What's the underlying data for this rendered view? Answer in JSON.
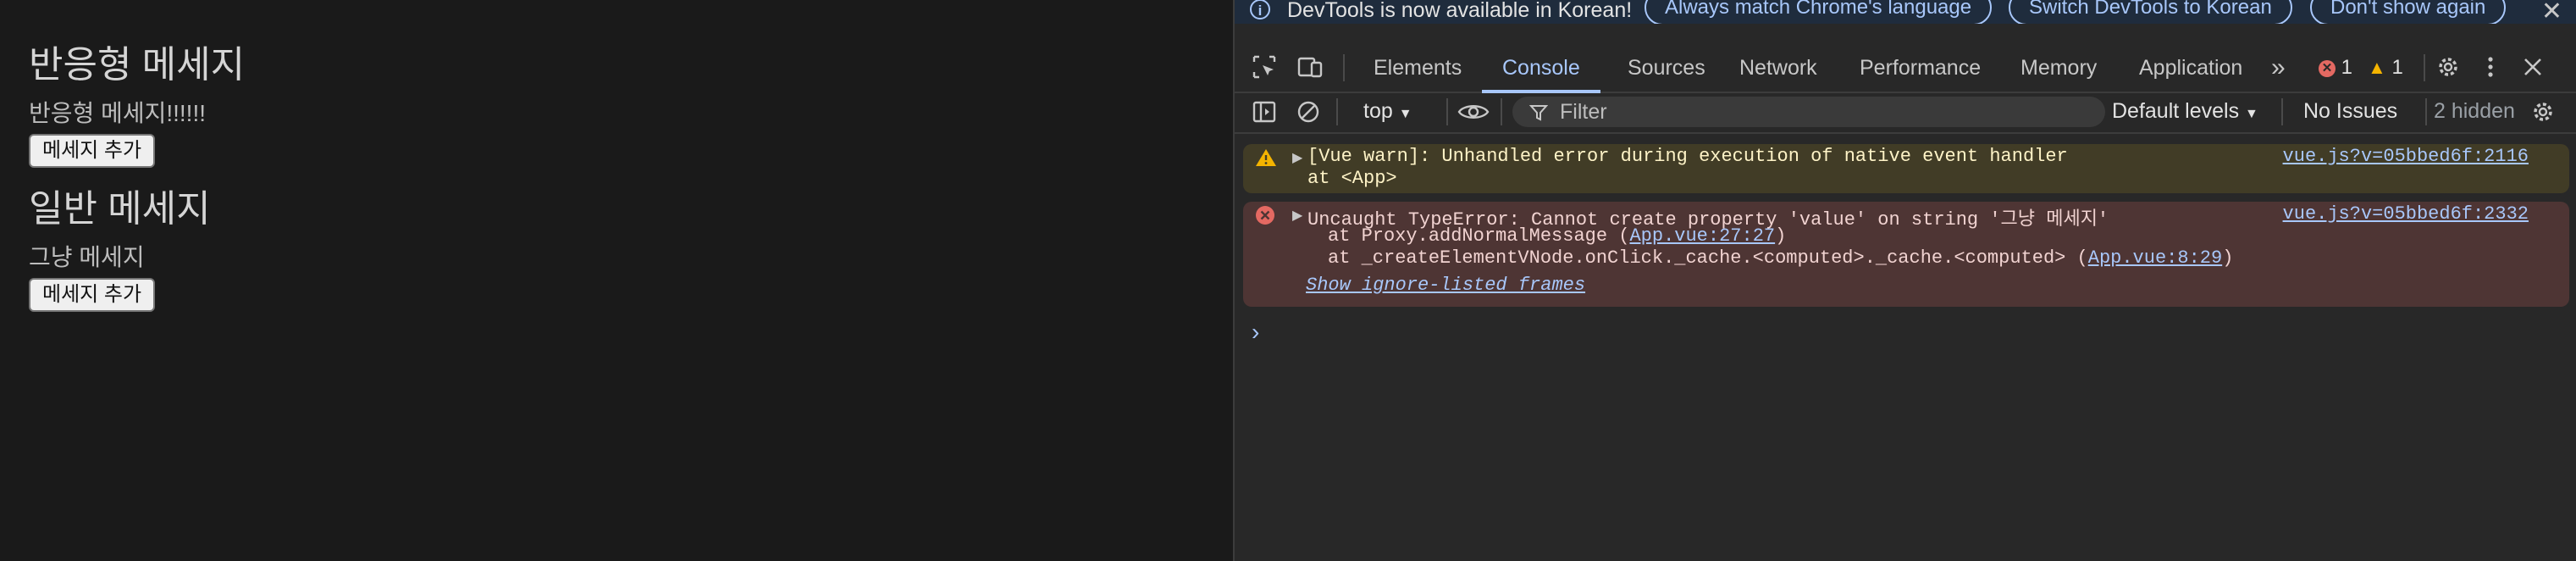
{
  "page": {
    "reactive_title": "반응형 메세지",
    "reactive_text": "반응형 메세지!!!!!!",
    "reactive_button": "메세지 추가",
    "normal_title": "일반 메세지",
    "normal_text": "그냥 메세지",
    "normal_button": "메세지 추가"
  },
  "devtools": {
    "infobar": {
      "message": "DevTools is now available in Korean!",
      "btn_match": "Always match Chrome's language",
      "btn_switch": "Switch DevTools to Korean",
      "btn_dont_show": "Don't show again",
      "close_icon": "✕"
    },
    "tabs": [
      "Elements",
      "Console",
      "Sources",
      "Network",
      "Performance",
      "Memory",
      "Application"
    ],
    "more_tabs": "»",
    "error_count": "1",
    "warning_count": "1",
    "toolbar": {
      "context": "top",
      "filter_placeholder": "Filter",
      "levels": "Default levels",
      "issues": "No Issues",
      "hidden": "2 hidden"
    },
    "console": {
      "warn": {
        "line1": "[Vue warn]: Unhandled error during execution of native event handler",
        "line2": "at <App>",
        "source": "vue.js?v=05bbed6f:2116"
      },
      "error": {
        "line1": "Uncaught TypeError: Cannot create property 'value' on string '그냥 메세지'",
        "line2_prefix": "at Proxy.addNormalMessage (",
        "line2_link": "App.vue:27:27",
        "line2_suffix": ")",
        "line3_prefix": "at _createElementVNode.onClick._cache.<computed>._cache.<computed> (",
        "line3_link": "App.vue:8:29",
        "line3_suffix": ")",
        "show_frames": "Show ignore-listed frames",
        "source": "vue.js?v=05bbed6f:2332"
      },
      "prompt": "›"
    },
    "colors": {
      "accent": "#a8c7fa",
      "warn_bg": "#413c26",
      "error_bg": "#4e3534",
      "error_icon": "#e46962",
      "warn_icon": "#f4b400"
    }
  }
}
